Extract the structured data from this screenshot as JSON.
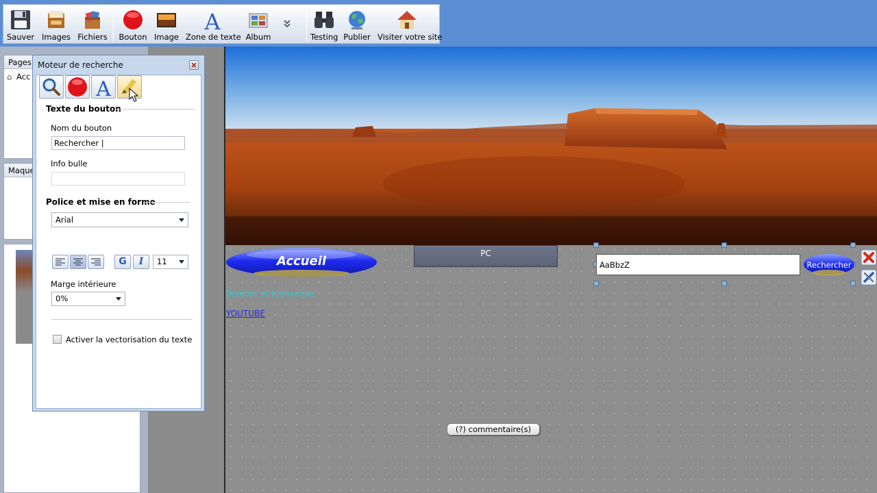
{
  "toolbar": {
    "buttons": [
      {
        "label": "Sauver",
        "icon": "floppy-disk-icon"
      },
      {
        "label": "Images",
        "icon": "images-folder-icon"
      },
      {
        "label": "Fichiers",
        "icon": "files-box-icon"
      },
      {
        "label": "Bouton",
        "icon": "red-button-icon"
      },
      {
        "label": "Image",
        "icon": "image-icon"
      },
      {
        "label": "Zone de texte",
        "icon": "text-zone-icon"
      },
      {
        "label": "Album",
        "icon": "album-icon"
      },
      {
        "label": "Testing",
        "icon": "binoculars-icon"
      },
      {
        "label": "Publier",
        "icon": "globe-icon"
      },
      {
        "label": "Visiter votre site",
        "icon": "house-icon"
      }
    ],
    "more_icon": "chevron-double-down-icon"
  },
  "left": {
    "pages_title": "Pages",
    "pages_item": "Acc",
    "models_title": "Maque"
  },
  "dialog": {
    "title": "Moteur de recherche",
    "section_button": "Texte du bouton",
    "name_label": "Nom du bouton",
    "name_value": "Rechercher |",
    "tooltip_label": "Info bulle",
    "tooltip_value": "",
    "section_font": "Police et mise en forme",
    "font_value": "Arial",
    "bold_label": "G",
    "italic_label": "I",
    "size_value": "11",
    "margin_label": "Marge intérieure",
    "margin_value": "0%",
    "vector_label": "Activer la vectorisation du texte",
    "vector_checked": false
  },
  "canvas": {
    "accueil_label": "Accueil",
    "pc_label": "PC",
    "search_value": "AaBbzZ",
    "search_button_label": "Rechercher",
    "welcome_text": "Bonjour et bienvenue",
    "youtube_link": "YOUTUBE",
    "comments_label": "(?) commentaire(s)"
  },
  "colors": {
    "toolbar_bg": "#5b8ed3",
    "dialog_bg": "#c8d8ec",
    "welcome_text": "#33c7d1",
    "link": "#1d2bdc",
    "accueil_blue": "#1e2cf0"
  }
}
